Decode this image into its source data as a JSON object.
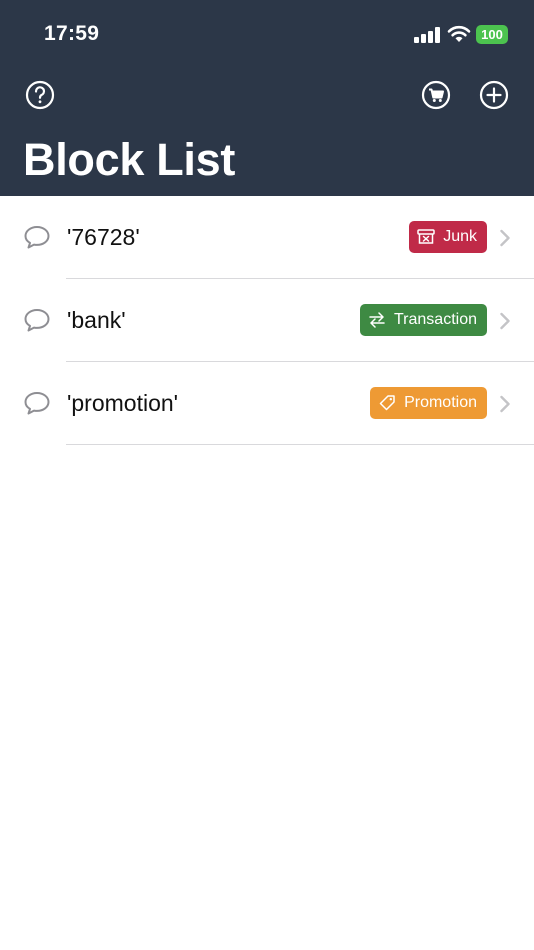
{
  "status_bar": {
    "time": "17:59",
    "battery": "100"
  },
  "header": {
    "title": "Block List",
    "icons": {
      "help": "question-circle-icon",
      "cart": "cart-icon",
      "add": "plus-circle-icon"
    },
    "background": "#2c3748"
  },
  "rules": [
    {
      "term": "'76728'",
      "category": "Junk",
      "category_icon": "junk-box-icon",
      "color": "#c02a48"
    },
    {
      "term": "'bank'",
      "category": "Transaction",
      "category_icon": "swap-arrows-icon",
      "color": "#3e8a43"
    },
    {
      "term": "'promotion'",
      "category": "Promotion",
      "category_icon": "tag-icon",
      "color": "#ee9a34"
    }
  ]
}
